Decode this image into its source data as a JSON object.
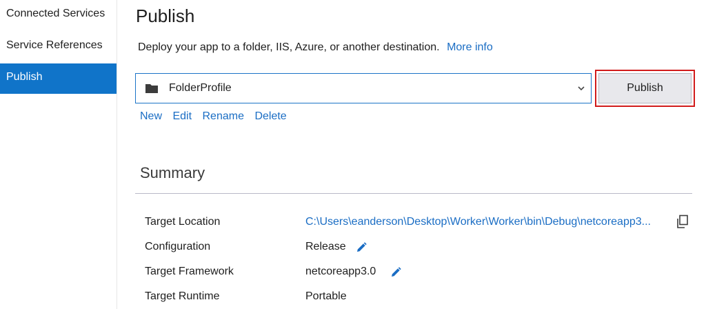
{
  "sidebar": {
    "items": [
      {
        "label": "Connected Services",
        "active": false
      },
      {
        "label": "Service References",
        "active": false
      },
      {
        "label": "Publish",
        "active": true
      }
    ]
  },
  "main": {
    "title": "Publish",
    "subtitle": "Deploy your app to a folder, IIS, Azure, or another destination.",
    "more_info": "More info",
    "profile": {
      "selected": "FolderProfile"
    },
    "publish_button": "Publish",
    "profile_actions": {
      "new": "New",
      "edit": "Edit",
      "rename": "Rename",
      "delete": "Delete"
    }
  },
  "summary": {
    "title": "Summary",
    "rows": [
      {
        "label": "Target Location",
        "value": "C:\\Users\\eanderson\\Desktop\\Worker\\Worker\\bin\\Debug\\netcoreapp3..."
      },
      {
        "label": "Configuration",
        "value": "Release"
      },
      {
        "label": "Target Framework",
        "value": "netcoreapp3.0"
      },
      {
        "label": "Target Runtime",
        "value": "Portable"
      }
    ]
  },
  "colors": {
    "accent": "#1074c9",
    "link": "#1a6dc4",
    "highlight_frame": "#d11a1a"
  },
  "icons": {
    "folder": "folder-icon",
    "dropdown": "chevron-down-icon",
    "edit": "pencil-icon",
    "copy": "copy-icon"
  }
}
